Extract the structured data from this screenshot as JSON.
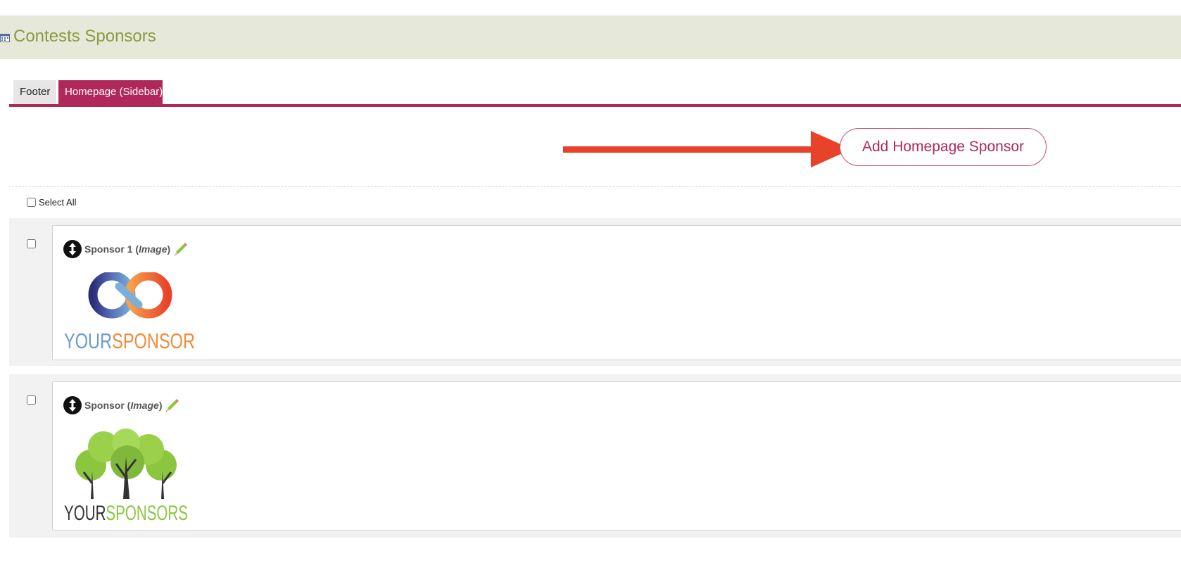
{
  "header": {
    "title": "Contests Sponsors",
    "icon": "calendar-icon",
    "background": "#e6e9da",
    "title_color": "#8a9a3e"
  },
  "tabs": [
    {
      "label": "Footer",
      "active": false
    },
    {
      "label": "Homepage (Sidebar)",
      "active": true
    }
  ],
  "accent_color": "#b0285a",
  "annotation_arrow_color": "#e8432a",
  "actions": {
    "add_label": "Add Homepage Sponsor"
  },
  "list": {
    "select_all_label": "Select All",
    "items": [
      {
        "name": "Sponsor 1",
        "type": "Image",
        "logo": {
          "word1": "YOUR",
          "word2": "SPONSOR",
          "graphic": "infinity-logo"
        }
      },
      {
        "name": "Sponsor",
        "type": "Image",
        "logo": {
          "word1": "YOUR",
          "word2": "SPONSORS",
          "graphic": "trees-logo"
        }
      }
    ]
  }
}
